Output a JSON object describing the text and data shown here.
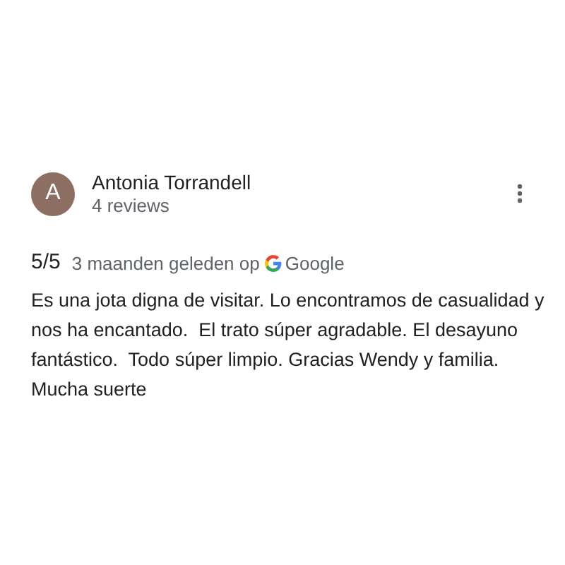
{
  "review": {
    "avatar_letter": "A",
    "author": "Antonia Torrandell",
    "author_meta": "4 reviews",
    "rating": "5/5",
    "time": "3 maanden geleden op",
    "source": "Google",
    "text": "Es una jota digna de visitar. Lo encontramos de casualidad y nos ha encantado.  El trato súper agradable. El desayuno fantástico.  Todo súper limpio. Gracias Wendy y familia. Mucha suerte"
  }
}
